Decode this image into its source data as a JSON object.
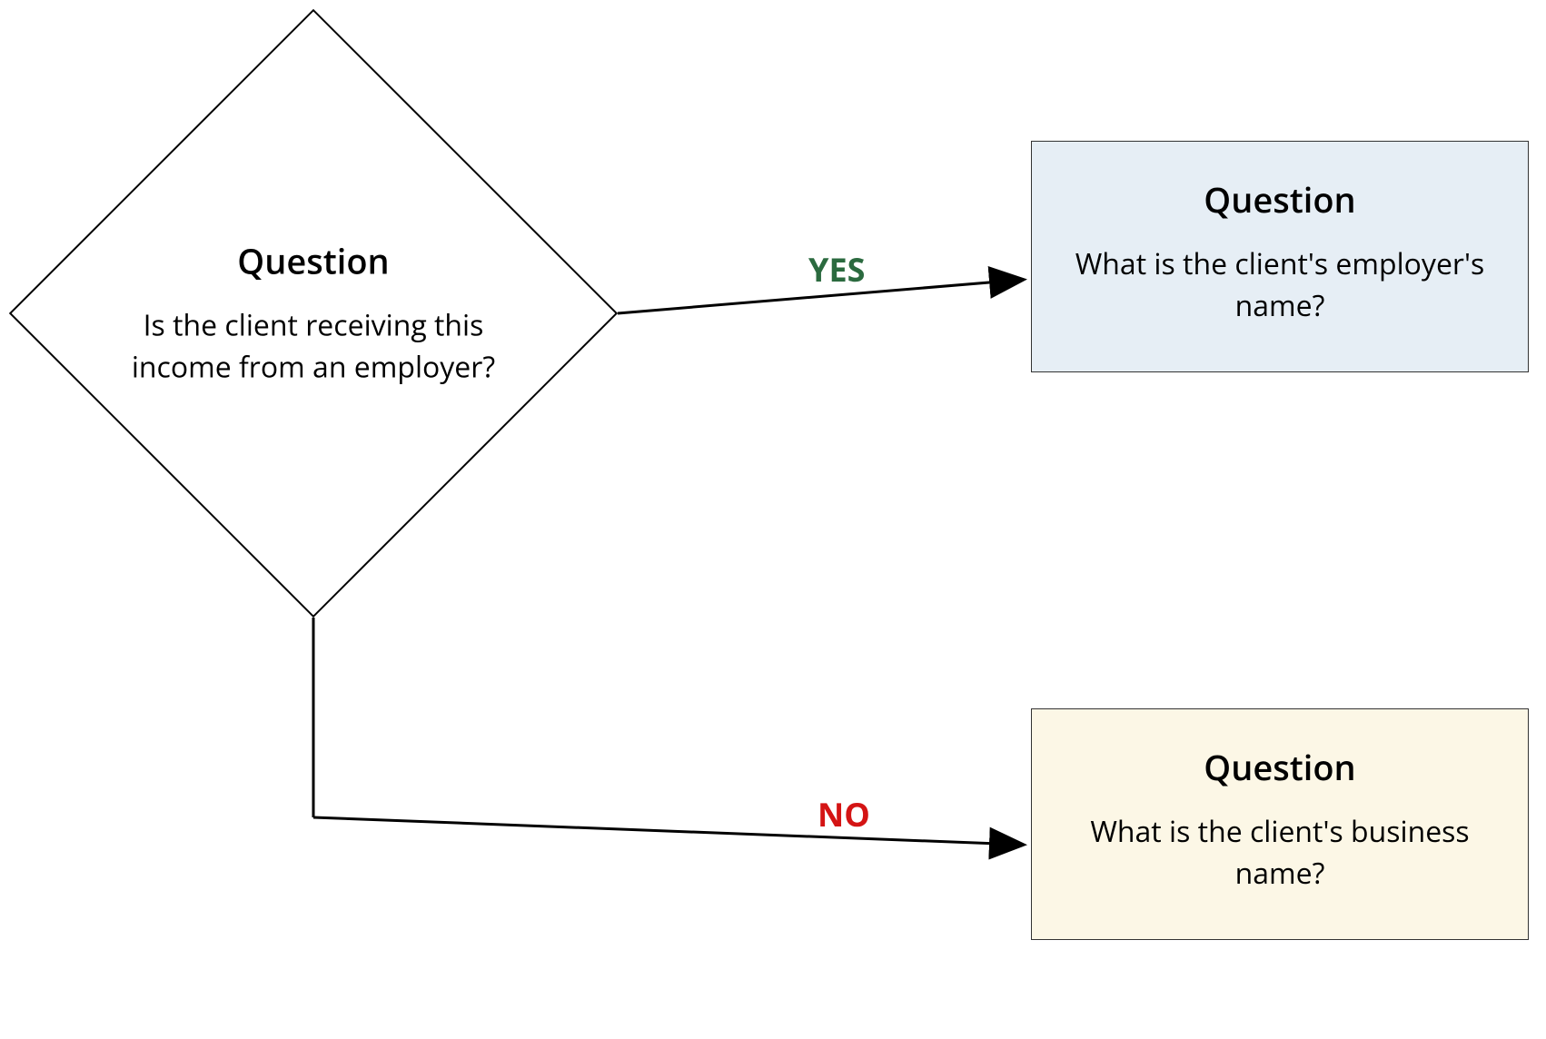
{
  "diagram": {
    "decision": {
      "title": "Question",
      "text": "Is the client receiving this income from an employer?"
    },
    "yes_branch": {
      "label": "YES",
      "node": {
        "title": "Question",
        "text": "What is the client's employer's name?"
      }
    },
    "no_branch": {
      "label": "NO",
      "node": {
        "title": "Question",
        "text": "What is the client's business name?"
      }
    },
    "colors": {
      "yes_label": "#2b6a3f",
      "no_label": "#d41414",
      "yes_box_bg": "#e6eef5",
      "no_box_bg": "#fcf7e6"
    }
  }
}
